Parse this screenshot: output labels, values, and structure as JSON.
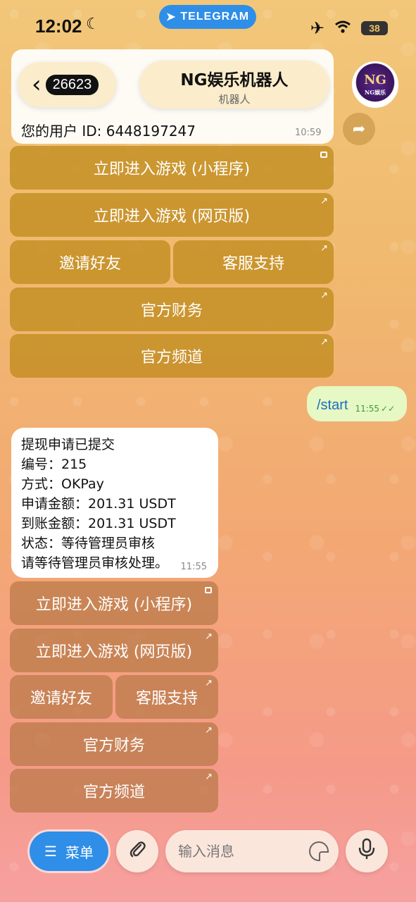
{
  "status_bar": {
    "time": "12:02",
    "app_label": "TELEGRAM",
    "battery": "38"
  },
  "header": {
    "back_count": "26623",
    "title": "NG娱乐机器人",
    "subtitle": "机器人",
    "avatar_text": "NG",
    "avatar_subtext": "NG娱乐"
  },
  "previous_message": {
    "text": "您的用户 ID: 6448197247",
    "time": "10:59"
  },
  "keyboard_top": {
    "play_mini": "立即进入游戏 (小程序)",
    "play_web": "立即进入游戏 (网页版)",
    "invite": "邀请好友",
    "support": "客服支持",
    "finance": "官方财务",
    "channel": "官方频道"
  },
  "outgoing": {
    "text": "/start",
    "time": "11:55"
  },
  "incoming": {
    "lines": [
      "提现申请已提交",
      "编号：215",
      "方式：OKPay",
      "申请金额：201.31 USDT",
      "到账金额：201.31 USDT",
      "状态：等待管理员审核",
      "请等待管理员审核处理。"
    ],
    "time": "11:55"
  },
  "keyboard_bottom": {
    "play_mini": "立即进入游戏 (小程序)",
    "play_web": "立即进入游戏 (网页版)",
    "invite": "邀请好友",
    "support": "客服支持",
    "finance": "官方财务",
    "channel": "官方频道"
  },
  "input_bar": {
    "menu_label": "菜单",
    "placeholder": "输入消息"
  },
  "colors": {
    "accent": "#2f8ee8",
    "button_gold": "#c08c1e"
  }
}
